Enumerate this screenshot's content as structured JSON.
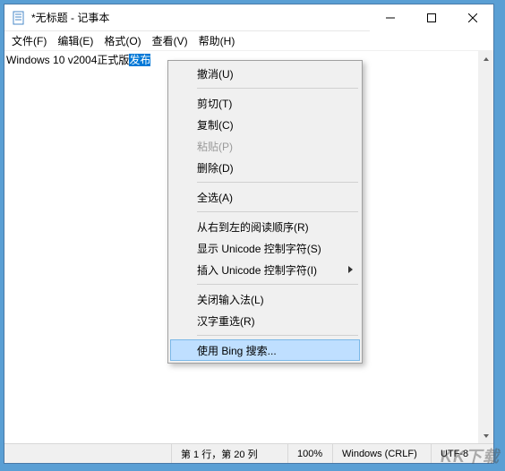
{
  "window": {
    "title": "*无标题 - 记事本"
  },
  "menubar": {
    "file": "文件(F)",
    "edit": "编辑(E)",
    "format": "格式(O)",
    "view": "查看(V)",
    "help": "帮助(H)"
  },
  "editor": {
    "text_before": "Windows 10 v2004正式版",
    "text_selected": "发布"
  },
  "context_menu": {
    "undo": "撤消(U)",
    "cut": "剪切(T)",
    "copy": "复制(C)",
    "paste": "粘贴(P)",
    "delete": "删除(D)",
    "select_all": "全选(A)",
    "rtl": "从右到左的阅读顺序(R)",
    "show_unicode": "显示 Unicode 控制字符(S)",
    "insert_unicode": "插入 Unicode 控制字符(I)",
    "close_ime": "关闭输入法(L)",
    "hanzi": "汉字重选(R)",
    "bing": "使用 Bing 搜索..."
  },
  "statusbar": {
    "position": "第 1 行，第 20 列",
    "zoom": "100%",
    "eol": "Windows (CRLF)",
    "encoding": "UTF-8"
  },
  "watermark": "KK下载"
}
